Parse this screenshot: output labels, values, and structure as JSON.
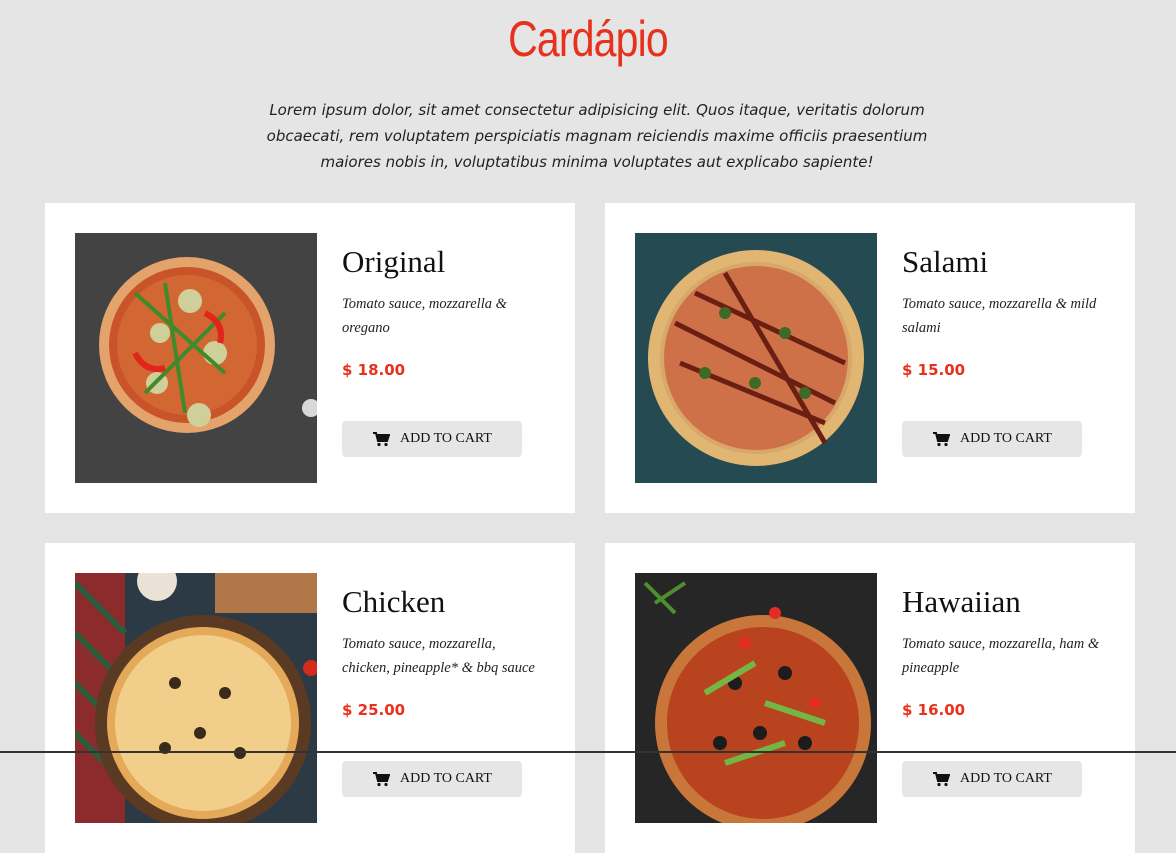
{
  "page": {
    "title": "Cardápio",
    "intro": "Lorem ipsum dolor, sit amet consectetur adipisicing elit. Quos itaque, veritatis dolorum obcaecati, rem voluptatem perspiciatis magnam reiciendis maxime officiis praesentium maiores nobis in, voluptatibus minima voluptates aut explicabo sapiente!"
  },
  "colors": {
    "accent": "#e8311c",
    "background": "#e5e5e5",
    "card": "#ffffff",
    "button": "#e6e6e6"
  },
  "menu": [
    {
      "name": "Original",
      "description": "Tomato sauce, mozzarella & oregano",
      "price": "$ 18.00",
      "button": "ADD TO CART",
      "button_icon": "cart-icon"
    },
    {
      "name": "Salami",
      "description": "Tomato sauce, mozzarella & mild salami",
      "price": "$ 15.00",
      "button": "ADD TO CART",
      "button_icon": "cart-icon"
    },
    {
      "name": "Chicken",
      "description": "Tomato sauce, mozzarella, chicken, pineapple* & bbq sauce",
      "price": "$ 25.00",
      "button": "ADD TO CART",
      "button_icon": "cart-icon"
    },
    {
      "name": "Hawaiian",
      "description": "Tomato sauce, mozzarella, ham & pineapple",
      "price": "$ 16.00",
      "button": "ADD TO CART",
      "button_icon": "cart-icon"
    }
  ]
}
